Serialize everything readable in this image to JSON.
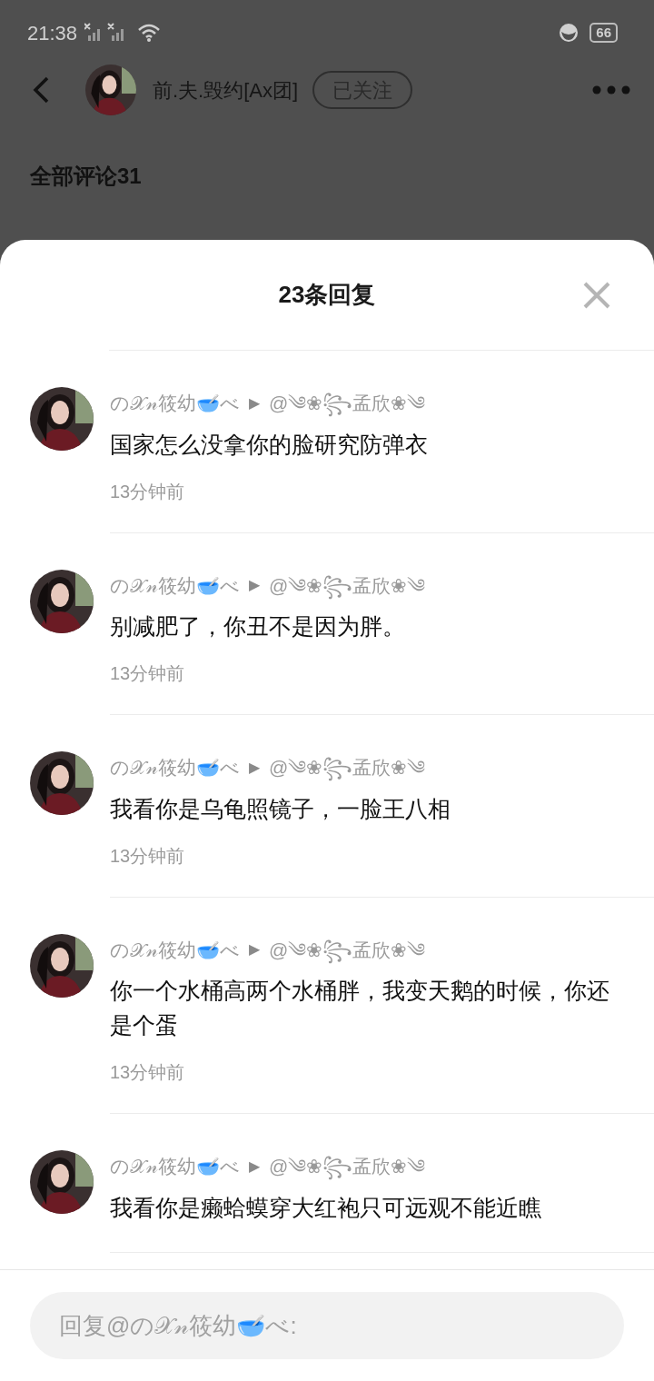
{
  "status_bar": {
    "time": "21:38",
    "battery": "66"
  },
  "header": {
    "author": "前.夫.毁约[Ax团]",
    "follow_button": "已关注"
  },
  "section_title": "全部评论31",
  "sheet": {
    "title": "23条回复"
  },
  "replies": [
    {
      "author": "の𝒳𝓃筱幼🥣べ",
      "arrow": "▶",
      "target": "@༄❀꧂孟欣❀༄",
      "text": "国家怎么没拿你的脸研究防弹衣",
      "time": "13分钟前"
    },
    {
      "author": "の𝒳𝓃筱幼🥣べ",
      "arrow": "▶",
      "target": "@༄❀꧂孟欣❀༄",
      "text": "别减肥了，你丑不是因为胖。",
      "time": "13分钟前"
    },
    {
      "author": "の𝒳𝓃筱幼🥣べ",
      "arrow": "▶",
      "target": "@༄❀꧂孟欣❀༄",
      "text": "我看你是乌龟照镜子，一脸王八相",
      "time": "13分钟前"
    },
    {
      "author": "の𝒳𝓃筱幼🥣べ",
      "arrow": "▶",
      "target": "@༄❀꧂孟欣❀༄",
      "text": "你一个水桶高两个水桶胖，我变天鹅的时候，你还是个蛋",
      "time": "13分钟前"
    },
    {
      "author": "の𝒳𝓃筱幼🥣べ",
      "arrow": "▶",
      "target": "@༄❀꧂孟欣❀༄",
      "text": "我看你是癞蛤蟆穿大红袍只可远观不能近瞧"
    }
  ],
  "reply_field": {
    "placeholder": "回复@の𝒳𝓃筱幼🥣べ:"
  }
}
